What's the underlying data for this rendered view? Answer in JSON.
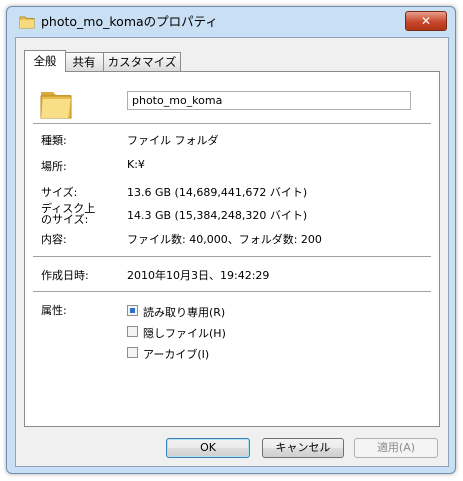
{
  "window": {
    "title": "photo_mo_komaのプロパティ",
    "close_glyph": "✕"
  },
  "tabs": [
    {
      "label": "全般",
      "active": true
    },
    {
      "label": "共有",
      "active": false
    },
    {
      "label": "カスタマイズ",
      "active": false
    }
  ],
  "general": {
    "folder_name": "photo_mo_koma",
    "type_label": "種類:",
    "type_value": "ファイル フォルダ",
    "location_label": "場所:",
    "location_value": "K:¥",
    "size_label": "サイズ:",
    "size_value": "13.6 GB (14,689,441,672 バイト)",
    "disk_size_label_1": "ディスク上",
    "disk_size_label_2": "のサイズ:",
    "disk_size_value": "14.3 GB (15,384,248,320 バイト)",
    "contents_label": "内容:",
    "contents_value": "ファイル数: 40,000、フォルダ数: 200",
    "created_label": "作成日時:",
    "created_value": "2010年10月3日、19:42:29",
    "attributes_label": "属性:",
    "attributes": [
      {
        "label": "読み取り専用(R)",
        "state": "indeterminate"
      },
      {
        "label": "隠しファイル(H)",
        "state": "unchecked"
      },
      {
        "label": "アーカイブ(I)",
        "state": "unchecked"
      }
    ]
  },
  "buttons": {
    "ok": "OK",
    "cancel": "キャンセル",
    "apply": "適用(A)"
  },
  "colors": {
    "title_bar": "#c9dff3",
    "close_button": "#c7462c",
    "checkbox_fill": "#2a6fd0"
  }
}
